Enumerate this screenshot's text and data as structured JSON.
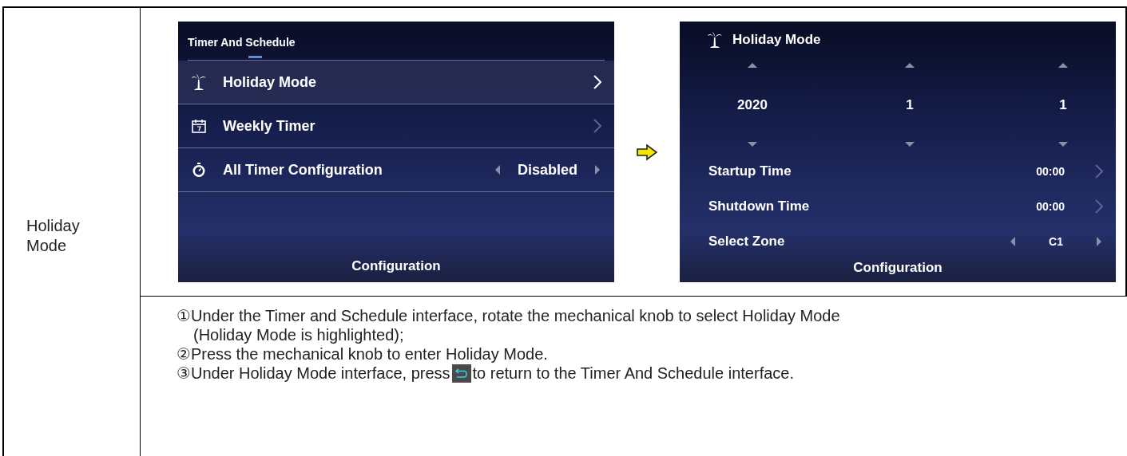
{
  "row_label": "Holiday Mode",
  "screens": [
    {
      "kind": "menu",
      "title": "Timer And Schedule",
      "items": [
        {
          "kind": "link",
          "label": "Holiday Mode",
          "selected": true
        },
        {
          "kind": "link",
          "label": "Weekly Timer",
          "selected": false
        },
        {
          "kind": "option",
          "label": "All Timer Configuration",
          "value": "Disabled",
          "selected": false
        }
      ],
      "footer": "Configuration"
    },
    {
      "kind": "holiday",
      "title": "Holiday Mode",
      "date": [
        "2020",
        "1",
        "1"
      ],
      "rows": [
        {
          "kind": "link",
          "label": "Startup Time",
          "value": "00:00"
        },
        {
          "kind": "link",
          "label": "Shutdown Time",
          "value": "00:00"
        },
        {
          "kind": "option",
          "label": "Select Zone",
          "value": "C1"
        }
      ],
      "footer": "Configuration"
    }
  ],
  "steps": [
    {
      "number": "①",
      "text": "Under the Timer and Schedule interface, rotate the mechanical knob to select Holiday Mode",
      "continuation": "(Holiday Mode is highlighted);"
    },
    {
      "number": "②",
      "text": "Press the mechanical knob to enter Holiday Mode."
    },
    {
      "number": "③",
      "text": "Under Holiday Mode interface, press",
      "text_after": "to return to the Timer And Schedule interface."
    }
  ]
}
